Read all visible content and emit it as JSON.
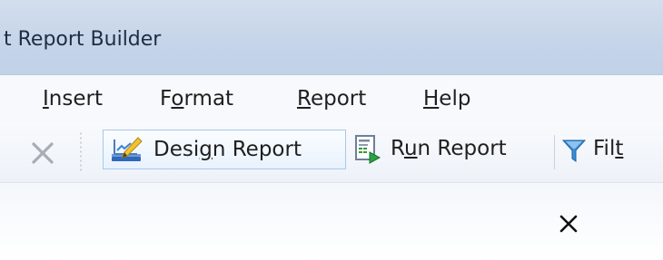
{
  "window": {
    "title": "t Report Builder"
  },
  "menu": {
    "items": [
      {
        "pre": "",
        "key": "I",
        "post": "nsert"
      },
      {
        "pre": "F",
        "key": "o",
        "post": "rmat"
      },
      {
        "pre": "",
        "key": "R",
        "post": "eport"
      },
      {
        "pre": "",
        "key": "H",
        "post": "elp"
      }
    ]
  },
  "toolbar": {
    "design": {
      "pre": "Desi",
      "key": "g",
      "post": "n Report"
    },
    "run": {
      "pre": "R",
      "key": "u",
      "post": "n Report"
    },
    "filter": {
      "pre": "Fil",
      "key": "t",
      "post": ""
    },
    "icons": [
      "close-x-icon",
      "design-report-icon",
      "run-report-icon",
      "filter-funnel-icon"
    ]
  },
  "colors": {
    "titlebar": "#c6d5e9",
    "hover_border": "#a6c9ea",
    "filter_blue": "#3a8fd9"
  }
}
